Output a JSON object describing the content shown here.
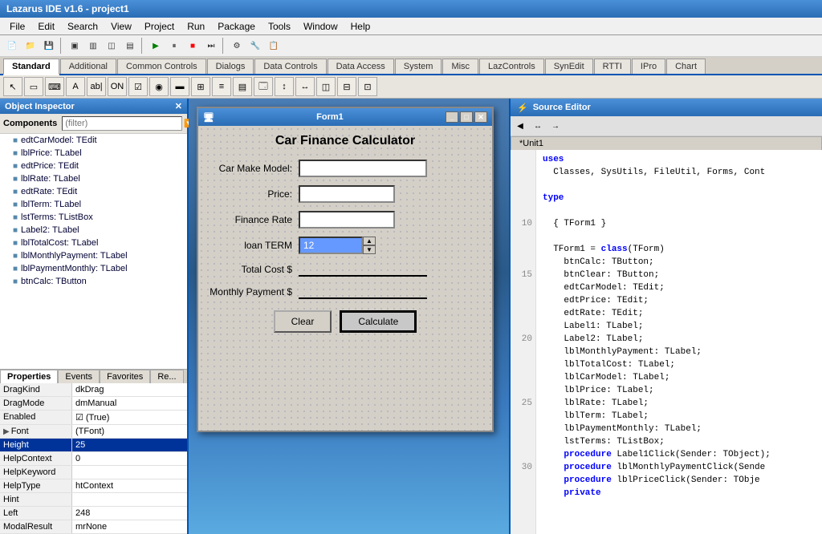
{
  "app": {
    "title": "Lazarus IDE v1.6 - project1"
  },
  "menubar": {
    "items": [
      "File",
      "Edit",
      "Search",
      "View",
      "Project",
      "Run",
      "Package",
      "Tools",
      "Window",
      "Help"
    ]
  },
  "tabs": {
    "items": [
      "Standard",
      "Additional",
      "Common Controls",
      "Dialogs",
      "Data Controls",
      "Data Access",
      "System",
      "Misc",
      "LazControls",
      "SynEdit",
      "RTTI",
      "IPro",
      "Chart"
    ],
    "active": "Standard"
  },
  "object_inspector": {
    "title": "Object Inspector",
    "components_label": "Components",
    "filter_placeholder": "(filter)",
    "items": [
      "edtCarModel: TEdit",
      "lblPrice: TLabel",
      "edtPrice: TEdit",
      "lblRate: TLabel",
      "edtRate: TEdit",
      "lblTerm: TLabel",
      "lstTerms: TListBox",
      "Label2: TLabel",
      "lblTotalCost: TLabel",
      "lblMonthlyPayment: TLabel",
      "lblPaymentMonthly: TLabel",
      "btnCalc: TButton"
    ]
  },
  "properties": {
    "tabs": [
      "Properties",
      "Events",
      "Favorites",
      "Re..."
    ],
    "active_tab": "Properties",
    "rows": [
      {
        "name": "DragKind",
        "value": "dkDrag",
        "selected": false
      },
      {
        "name": "DragMode",
        "value": "dmManual",
        "selected": false
      },
      {
        "name": "Enabled",
        "value": "✓ (True)",
        "selected": false,
        "has_checkbox": true
      },
      {
        "name": "Font",
        "value": "(TFont)",
        "selected": false,
        "has_expand": true
      },
      {
        "name": "Height",
        "value": "25",
        "selected": true
      },
      {
        "name": "HelpContext",
        "value": "0",
        "selected": false
      },
      {
        "name": "HelpKeyword",
        "value": "",
        "selected": false
      },
      {
        "name": "HelpType",
        "value": "htContext",
        "selected": false
      },
      {
        "name": "Hint",
        "value": "",
        "selected": false
      },
      {
        "name": "Left",
        "value": "248",
        "selected": false
      },
      {
        "name": "ModalResult",
        "value": "mrNone",
        "selected": false
      }
    ]
  },
  "form": {
    "title": "Form1",
    "main_title": "Car Finance Calculator",
    "fields": [
      {
        "label": "Car Make Model:",
        "type": "input",
        "value": ""
      },
      {
        "label": "Price:",
        "type": "input",
        "value": ""
      },
      {
        "label": "Finance Rate",
        "type": "input",
        "value": ""
      },
      {
        "label": "loan TERM",
        "type": "spin",
        "value": "12"
      },
      {
        "label": "Total Cost $",
        "type": "underline",
        "value": ""
      },
      {
        "label": "Monthly Payment $",
        "type": "underline",
        "value": ""
      }
    ],
    "buttons": [
      {
        "label": "Clear",
        "selected": false
      },
      {
        "label": "Calculate",
        "selected": true
      }
    ]
  },
  "source_editor": {
    "title": "Source Editor",
    "tab": "*Unit1",
    "lines": [
      {
        "num": "",
        "code": ""
      },
      {
        "num": "",
        "code": ""
      },
      {
        "num": "",
        "code": "uses"
      },
      {
        "num": "",
        "code": "  Classes, SysUtils, FileUtil, Forms, Cont"
      },
      {
        "num": "",
        "code": ""
      },
      {
        "num": "10",
        "code": "type"
      },
      {
        "num": "",
        "code": ""
      },
      {
        "num": "",
        "code": "  { TForm1 }"
      },
      {
        "num": "",
        "code": ""
      },
      {
        "num": "15",
        "code": "  TForm1 = class(TForm)"
      },
      {
        "num": "",
        "code": "    btnCalc: TButton;"
      },
      {
        "num": "",
        "code": "    btnClear: TButton;"
      },
      {
        "num": "",
        "code": "    edtCarModel: TEdit;"
      },
      {
        "num": "",
        "code": "    edtPrice: TEdit;"
      },
      {
        "num": "20",
        "code": "    edtRate: TEdit;"
      },
      {
        "num": "",
        "code": "    Label1: TLabel;"
      },
      {
        "num": "",
        "code": "    Label2: TLabel;"
      },
      {
        "num": "",
        "code": "    lblMonthlyPayment: TLabel;"
      },
      {
        "num": "",
        "code": "    lblTotalCost: TLabel;"
      },
      {
        "num": "25",
        "code": "    lblCarModel: TLabel;"
      },
      {
        "num": "",
        "code": "    lblPrice: TLabel;"
      },
      {
        "num": "",
        "code": "    lblRate: TLabel;"
      },
      {
        "num": "",
        "code": "    lblTerm: TLabel;"
      },
      {
        "num": "",
        "code": "    lblPaymentMonthly: TLabel;"
      },
      {
        "num": "30",
        "code": "    lstTerms: TListBox;"
      },
      {
        "num": "",
        "code": "    procedure Label1Click(Sender: TObject);"
      },
      {
        "num": "",
        "code": "    procedure lblMonthlyPaymentClick(Sende"
      },
      {
        "num": "",
        "code": "    procedure lblPriceClick(Sender: TObje"
      },
      {
        "num": "",
        "code": "    private"
      }
    ]
  }
}
